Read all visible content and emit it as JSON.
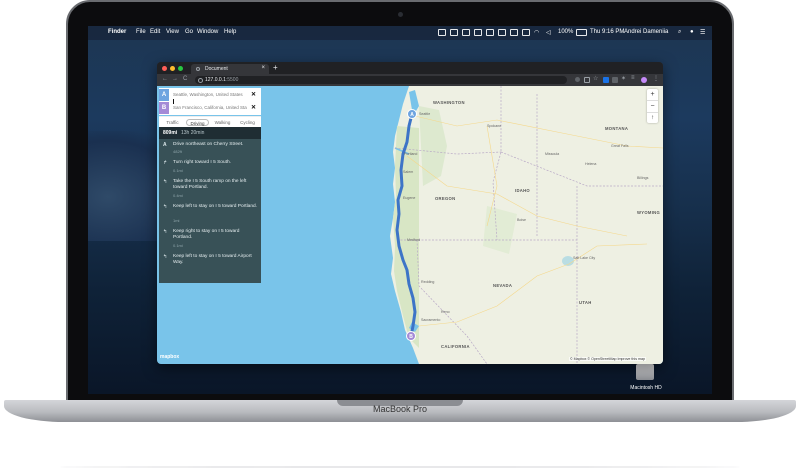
{
  "device": {
    "label": "MacBook Pro"
  },
  "menubar": {
    "apple": "",
    "items": [
      "Finder",
      "File",
      "Edit",
      "View",
      "Go",
      "Window",
      "Help"
    ],
    "battery": "100%",
    "clock": "Thu 9:16 PM",
    "user": "Andrei Dameniia"
  },
  "desktop": {
    "disk_label": "Macintosh HD"
  },
  "browser": {
    "tab_title": "Document",
    "tab_close": "×",
    "new_tab": "+",
    "url_host": "127.0.0.1",
    "url_port": ":5500",
    "back": "←",
    "forward": "→",
    "reload": "C"
  },
  "directions": {
    "origin": {
      "badge": "A",
      "value": "Seattle, Washington, United States",
      "clear": "✕"
    },
    "destination": {
      "badge": "B",
      "value": "San Francisco, California, United States",
      "clear": "✕"
    },
    "profiles": [
      {
        "label": "Traffic"
      },
      {
        "label": "Driving",
        "active": true
      },
      {
        "label": "Walking"
      },
      {
        "label": "Cycling"
      }
    ],
    "summary": {
      "distance": "809mi",
      "duration": "13h 20min"
    },
    "steps": [
      {
        "icon": "A",
        "text": "Drive northeast on Cherry Street.",
        "distance": "482ft"
      },
      {
        "icon": "↱",
        "text": "Turn right toward I 5 South.",
        "distance": "0.1mi"
      },
      {
        "icon": "↰",
        "text": "Take the I 5 South ramp on the left toward Portland.",
        "distance": "0.4mi"
      },
      {
        "icon": "↰",
        "text": "Keep left to stay on I 5 toward Portland.",
        "distance": "1mi"
      },
      {
        "icon": "↰",
        "text": "Keep right to stay on I 5 toward Portland.",
        "distance": "0.1mi"
      },
      {
        "icon": "↰",
        "text": "Keep left to stay on I 5 toward Airport Way.",
        "distance": ""
      }
    ]
  },
  "map": {
    "zoom_in": "+",
    "zoom_out": "−",
    "compass": "↑",
    "attribution": "© Mapbox © OpenStreetMap  Improve this map",
    "logo": "mapbox",
    "markers": {
      "start": "A",
      "end": "B"
    },
    "states": [
      "WASHINGTON",
      "MONTANA",
      "IDAHO",
      "OREGON",
      "WYOMING",
      "NEVADA",
      "UTAH",
      "CALIFORNIA"
    ],
    "cities": [
      "Seattle",
      "Spokane",
      "Portland",
      "Salem",
      "Eugene",
      "Boise",
      "Reno",
      "Sacramento",
      "Salt Lake City",
      "Helena",
      "Great Falls",
      "Billings",
      "Missoula",
      "Redding",
      "Medford"
    ],
    "colors": {
      "water": "#79c4ea",
      "land": "#eef0e3",
      "route": "#3d74c7",
      "forest": "#d8e6c5"
    }
  }
}
